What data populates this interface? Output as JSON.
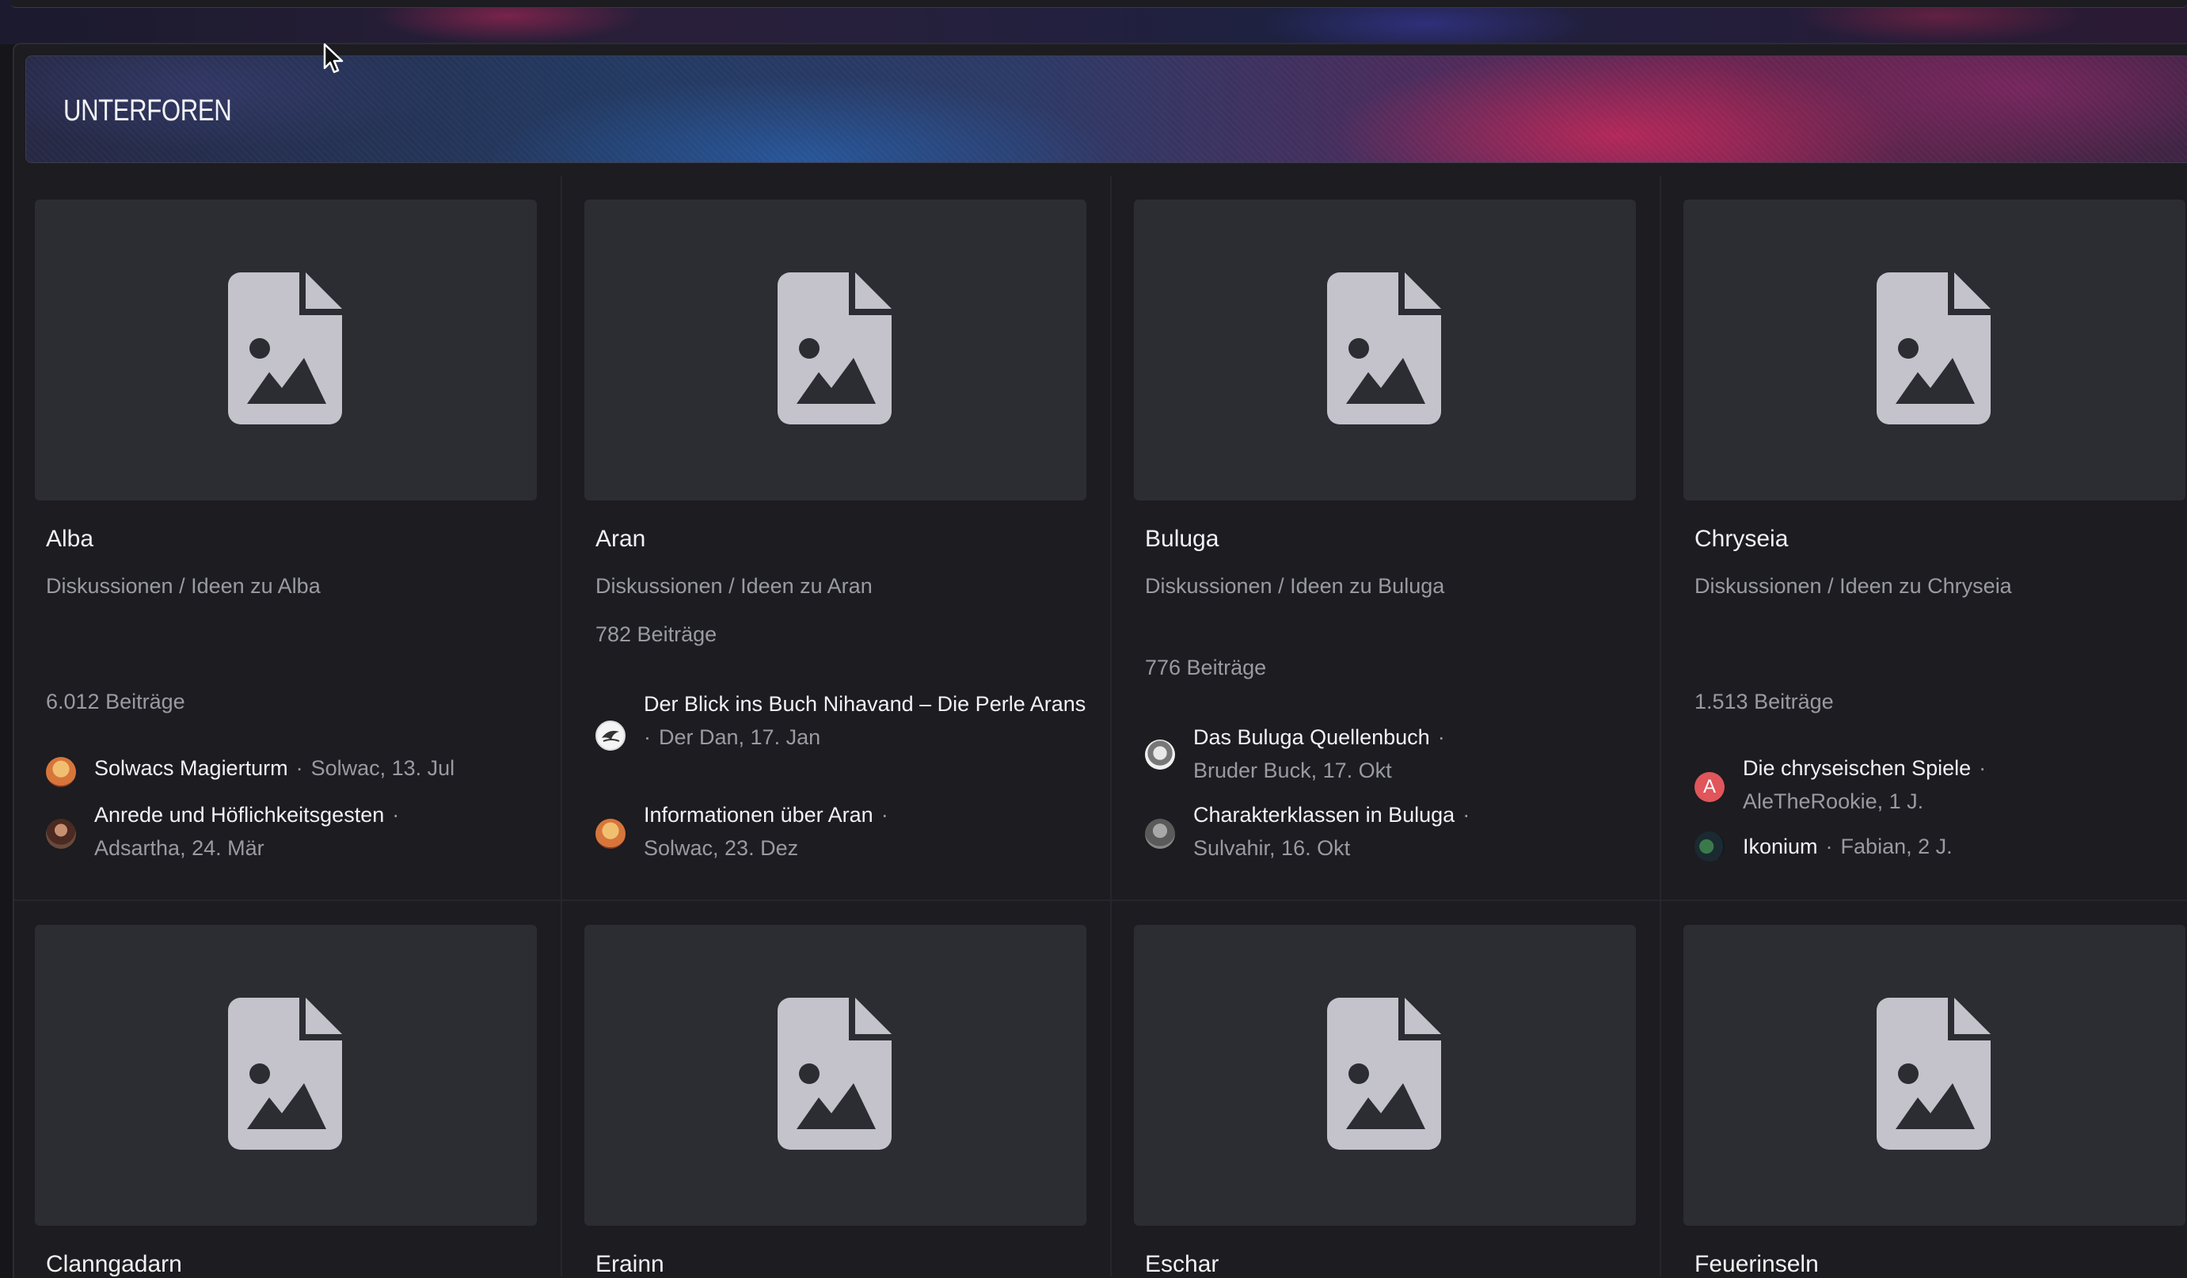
{
  "section": {
    "title": "UNTERFOREN"
  },
  "cards": [
    {
      "title": "Alba",
      "description": "Diskussionen / Ideen zu Alba",
      "posts": "6.012 Beiträge",
      "threads": [
        {
          "title": "Solwacs Magierturm",
          "meta": "Solwac, 13. Jul",
          "avatar": "orange-avatar"
        },
        {
          "title": "Anrede und Höflichkeitsgesten",
          "meta": "Adsartha, 24. Mär",
          "avatar": "portrait-avatar"
        }
      ]
    },
    {
      "title": "Aran",
      "description": "Diskussionen / Ideen zu Aran",
      "posts": "782 Beiträge",
      "threads": [
        {
          "title": "Der Blick ins Buch Nihavand – Die Perle Arans",
          "meta": "Der Dan, 17. Jan",
          "avatar": "logo-avatar"
        },
        {
          "title": "Informationen über Aran",
          "meta": "Solwac, 23. Dez",
          "avatar": "orange-avatar"
        }
      ]
    },
    {
      "title": "Buluga",
      "description": "Diskussionen / Ideen zu Buluga",
      "posts": "776 Beiträge",
      "threads": [
        {
          "title": "Das Buluga Quellenbuch",
          "meta": "Bruder Buck, 17. Okt",
          "avatar": "sketch-avatar"
        },
        {
          "title": "Charakterklassen in Buluga",
          "meta": "Sulvahir, 16. Okt",
          "avatar": "grey-avatar"
        }
      ]
    },
    {
      "title": "Chryseia",
      "description": "Diskussionen / Ideen zu Chryseia",
      "posts": "1.513 Beiträge",
      "threads": [
        {
          "title": "Die chryseischen Spiele",
          "meta": "AleTheRookie, 1 J.",
          "avatar": "letter-avatar",
          "initial": "A"
        },
        {
          "title": "Ikonium",
          "meta": "Fabian, 2 J.",
          "avatar": "dark-avatar"
        }
      ]
    },
    {
      "title": "Clanngadarn"
    },
    {
      "title": "Erainn"
    },
    {
      "title": "Eschar"
    },
    {
      "title": "Feuerinseln"
    }
  ],
  "colors": {
    "background": "#16161a",
    "panel": "#1c1c21",
    "thumbnail": "#2c2c33",
    "placeholder_icon": "#c4c3cc",
    "text_primary": "#f2f2f5",
    "text_secondary": "#9a9aa3",
    "letter_avatar": "#e0565a"
  },
  "icons": {
    "thumbnail": "image-file-placeholder-icon",
    "cursor": "mouse-pointer-icon"
  }
}
